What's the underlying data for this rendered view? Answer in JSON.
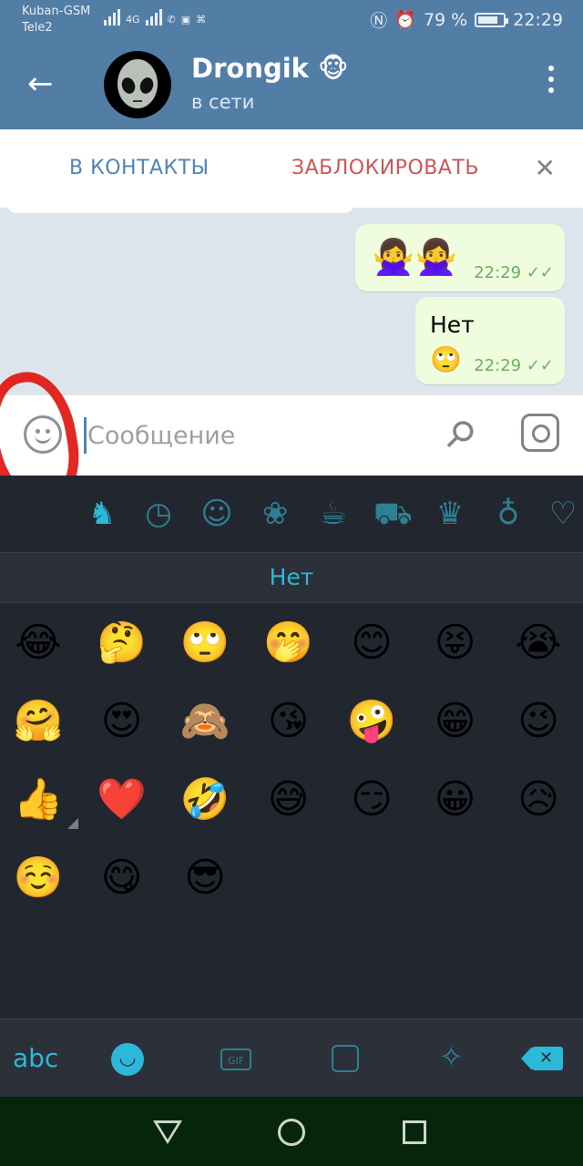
{
  "status_bar": {
    "carrier1": "Kuban-GSM",
    "carrier2": "Tele2",
    "network": "4G",
    "battery": "79 %",
    "battery_level": 0.79,
    "time": "22:29"
  },
  "header": {
    "name": "Drongik 🐵",
    "status": "в сети",
    "avatar_emoji": "👽"
  },
  "actions": {
    "add_contact": "В КОНТАКТЫ",
    "block": "ЗАБЛОКИРОВАТЬ"
  },
  "messages": [
    {
      "emoji": "🙅‍♀️🙅‍♀️",
      "time": "22:29"
    },
    {
      "text": "Нет",
      "emoji": "🙄",
      "time": "22:29"
    }
  ],
  "input": {
    "placeholder": "Сообщение"
  },
  "emoji_panel": {
    "suggestion": "Нет",
    "emojis": [
      "😂",
      "🤔",
      "🙄",
      "🤭",
      "😊",
      "😝",
      "😭",
      "🤗",
      "😍",
      "🙈",
      "😘",
      "🤪",
      "😁",
      "😉",
      "👍",
      "❤️",
      "🤣",
      "😅",
      "😏",
      "😀",
      "😥",
      "☺️",
      "😋",
      "😎"
    ],
    "abc": "abc",
    "gif": "GIF"
  },
  "colors": {
    "header": "#527ea6",
    "accent": "#2cb8d8",
    "block_red": "#cf5555",
    "bubble": "#effdde",
    "check_green": "#6cae5e"
  }
}
